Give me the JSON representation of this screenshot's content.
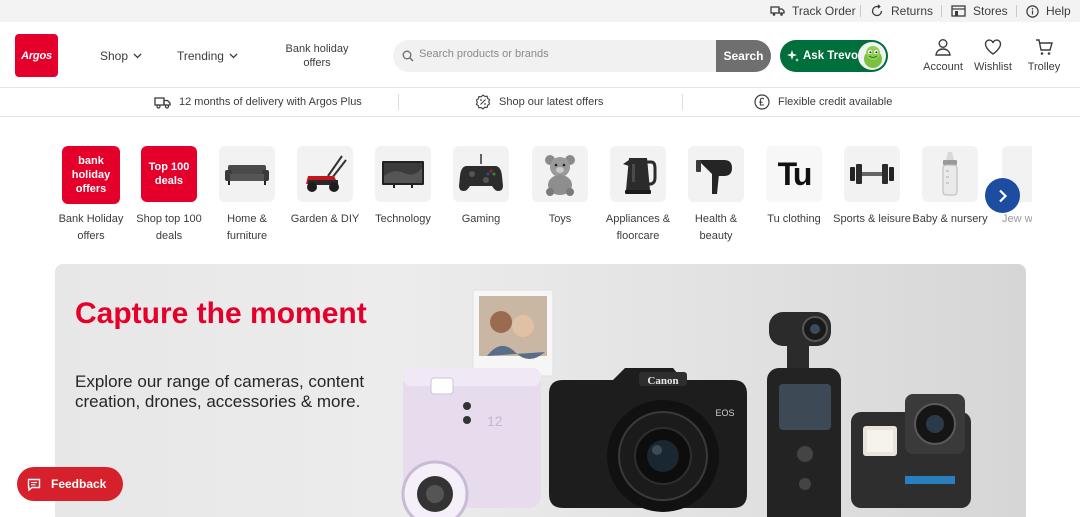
{
  "utility_bar": {
    "track_order": "Track Order",
    "returns": "Returns",
    "stores": "Stores",
    "help": "Help"
  },
  "header": {
    "logo_text": "Argos",
    "nav": {
      "shop": "Shop",
      "trending": "Trending",
      "bank_holiday": "Bank holiday offers"
    },
    "search": {
      "placeholder": "Search products or brands",
      "button": "Search"
    },
    "ask_trevor": "Ask Trevor",
    "account": "Account",
    "wishlist": "Wishlist",
    "trolley": "Trolley"
  },
  "benefits": [
    "12 months of delivery with Argos Plus",
    "Shop our latest offers",
    "Flexible credit available"
  ],
  "categories": [
    {
      "label": "Bank Holiday offers",
      "tile_text": "bank holiday offers",
      "icon": "bank-holiday-tile"
    },
    {
      "label": "Shop top 100 deals",
      "tile_text": "Top 100 deals",
      "icon": "top-100-tile"
    },
    {
      "label": "Home & furniture",
      "icon": "sofa-icon"
    },
    {
      "label": "Garden & DIY",
      "icon": "lawnmower-icon"
    },
    {
      "label": "Technology",
      "icon": "tv-icon"
    },
    {
      "label": "Gaming",
      "icon": "controller-icon"
    },
    {
      "label": "Toys",
      "icon": "teddy-bear-icon"
    },
    {
      "label": "Appliances & floorcare",
      "icon": "kettle-icon"
    },
    {
      "label": "Health & beauty",
      "icon": "hairdryer-icon"
    },
    {
      "label": "Tu clothing",
      "tile_text": "Tu",
      "icon": "tu-logo-icon"
    },
    {
      "label": "Sports & leisure",
      "icon": "dumbbell-icon"
    },
    {
      "label": "Baby & nursery",
      "icon": "baby-bottle-icon"
    },
    {
      "label": "Jew w",
      "icon": "jewellery-icon"
    }
  ],
  "hero": {
    "title": "Capture the moment",
    "subtitle": "Explore our range of cameras, content creation, drones, accessories & more.",
    "camera_brand": "Canon",
    "camera_model": "EOS"
  },
  "feedback": "Feedback",
  "colors": {
    "brand_red": "#e4002b",
    "trevor_green": "#006f3c",
    "carousel_blue": "#1c4da1",
    "search_button": "#6f6f6f"
  }
}
